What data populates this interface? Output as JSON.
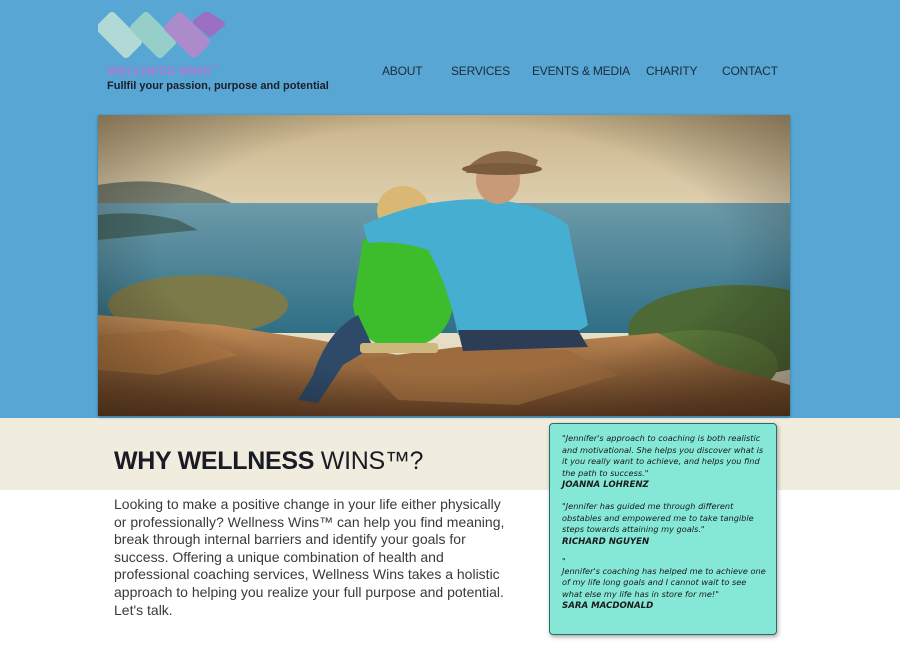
{
  "brand": {
    "name_part1": "WELLNESS",
    "name_part2": "WINS",
    "trademark": "™",
    "tagline": "Fullfil your passion, purpose and potential",
    "logo_colors": [
      "#b6dcd6",
      "#9ad2c9",
      "#b08acb",
      "#9b6fc2"
    ]
  },
  "nav": {
    "items": [
      "ABOUT",
      "SERVICES",
      "EVENTS & MEDIA",
      "CHARITY",
      "CONTACT"
    ]
  },
  "colors": {
    "header_background": "#57a6d4",
    "band_background": "#f0eddf",
    "testimonial_background": "#85e8d6"
  },
  "main": {
    "headline_bold": "WHY WELLNESS",
    "headline_rest": "WINS™?",
    "body": "Looking to make a positive change in your life either physically or professionally? Wellness Wins™ can help you find meaning, break through internal barriers and identify your goals for success. Offering a unique combination of health and professional coaching services, Wellness Wins takes a holistic approach to helping you realize your full purpose and potential. Let's talk."
  },
  "testimonials": [
    {
      "quote": "\"Jennifer's approach to coaching is both realistic and motivational. She helps you discover what is it you really want to achieve, and helps you find the path to success.\"",
      "author": "JOANNA LOHRENZ"
    },
    {
      "quote": "\"Jennifer has guided me through different obstables and empowered me to take tangible steps towards attaining my goals.\"",
      "author": "RICHARD NGUYEN"
    },
    {
      "stray": "\"",
      "quote": "Jennifer's coaching has helped me to achieve one of my life long goals and I cannot wait to see what else my life has in store for me!\"",
      "author": "SARA MACDONALD"
    }
  ]
}
